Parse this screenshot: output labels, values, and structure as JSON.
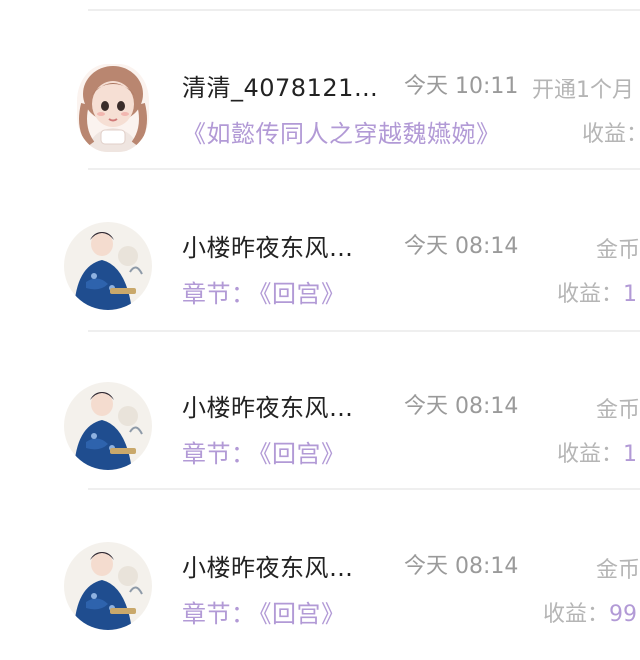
{
  "rows": [
    {
      "username": "清清_4078121…",
      "time": "今天 10:11",
      "action": "开通1个月",
      "content": "《如懿传同人之穿越魏嬿婉》",
      "income_label": "收益：",
      "income_value": ""
    },
    {
      "username": "小楼昨夜东风…",
      "time": "今天 08:14",
      "action": "金币",
      "content_label": "章节：",
      "content": "《回宫》",
      "income_label": "收益：",
      "income_value": "1"
    },
    {
      "username": "小楼昨夜东风…",
      "time": "今天 08:14",
      "action": "金币",
      "content_label": "章节：",
      "content": "《回宫》",
      "income_label": "收益：",
      "income_value": "1"
    },
    {
      "username": "小楼昨夜东风…",
      "time": "今天 08:14",
      "action": "金币",
      "content_label": "章节：",
      "content": "《回宫》",
      "income_label": "收益：",
      "income_value": "99"
    }
  ],
  "colors": {
    "accent": "#b29ad6",
    "muted": "#9a9a9a",
    "faint": "#b5b5b5",
    "title": "#222222"
  },
  "icons": {
    "avatar_1": "avatar-girl-illustration",
    "avatar_2": "avatar-man-blue-robe-illustration"
  }
}
